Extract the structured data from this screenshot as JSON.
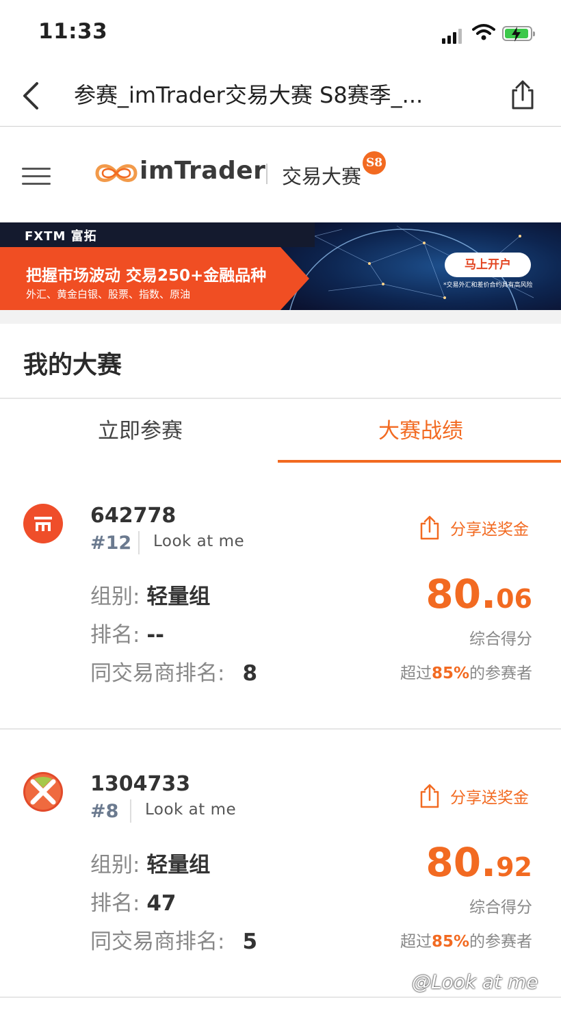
{
  "status_bar": {
    "time": "11:33"
  },
  "nav": {
    "title": "参赛_imTrader交易大赛 S8赛季_..."
  },
  "site_header": {
    "brand": "imTrader",
    "subtitle": "交易大赛",
    "badge": "S8"
  },
  "banner": {
    "brand": "FXTM 富拓",
    "headline": "把握市场波动 交易250+金融品种",
    "subline": "外汇、黄金白银、股票、指数、原油",
    "cta": "马上开户",
    "risk_note": "*交易外汇和差价合约具有高风险"
  },
  "section": {
    "title": "我的大赛"
  },
  "tabs": [
    {
      "label": "立即参赛",
      "active": false
    },
    {
      "label": "大赛战绩",
      "active": true
    }
  ],
  "accent_color": "#f26a21",
  "cards": [
    {
      "account": "642778",
      "rank_tag": "#12",
      "nickname": "Look at me",
      "share_label": "分享送奖金",
      "group_label": "组别: ",
      "group_value": "轻量组",
      "rank_label": "排名: ",
      "rank_value": "--",
      "broker_rank_label": "同交易商排名:",
      "broker_rank_value": "8",
      "score_int": "80.",
      "score_dec": "06",
      "score_caption": "综合得分",
      "beat_prefix": "超过",
      "beat_pct": "85%",
      "beat_suffix": "的参赛者",
      "broker_icon": "fxtm-style-logo"
    },
    {
      "account": "1304733",
      "rank_tag": "#8",
      "nickname": "Look at me",
      "share_label": "分享送奖金",
      "group_label": "组别: ",
      "group_value": "轻量组",
      "rank_label": "排名: ",
      "rank_value": "47",
      "broker_rank_label": "同交易商排名:",
      "broker_rank_value": "5",
      "score_int": "80.",
      "score_dec": "92",
      "score_caption": "综合得分",
      "beat_prefix": "超过",
      "beat_pct": "85%",
      "beat_suffix": "的参赛者",
      "broker_icon": "fxtm-x-logo"
    }
  ],
  "watermark": "@Look at me"
}
